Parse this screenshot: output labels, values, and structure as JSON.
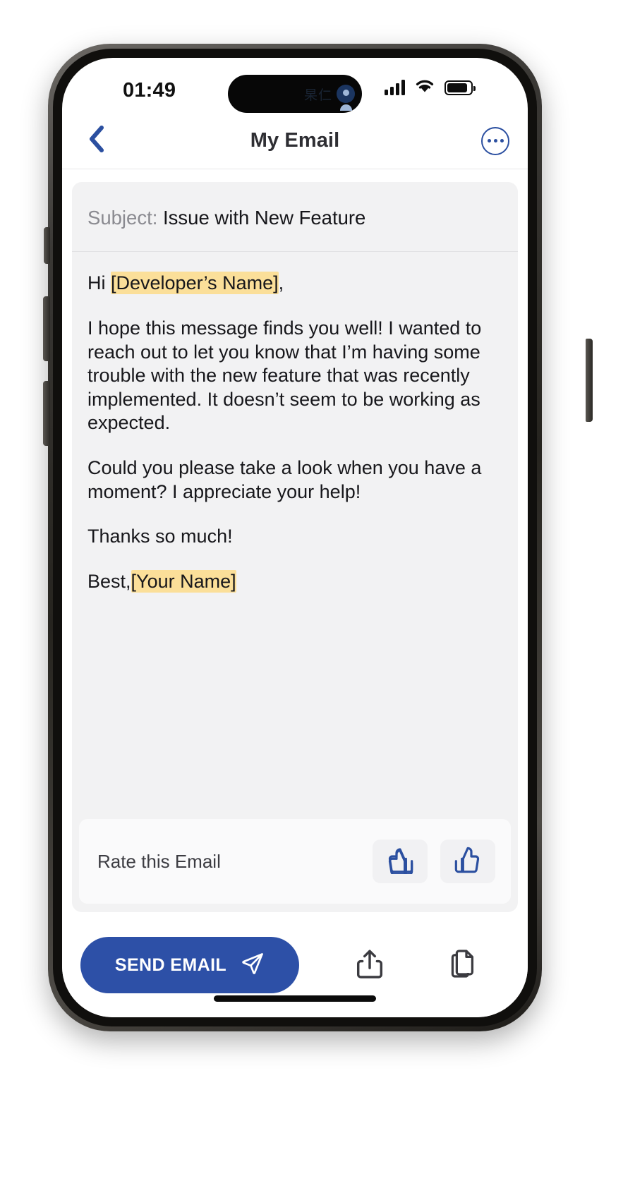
{
  "status_bar": {
    "time": "01:49",
    "island_label": "杲仁",
    "avatar_icon": "person-circle-icon",
    "cellular_icon": "cellular-bars-icon",
    "wifi_icon": "wifi-icon",
    "battery_icon": "battery-icon"
  },
  "nav_bar": {
    "back_icon": "chevron-left-icon",
    "title": "My Email",
    "more_icon": "ellipsis-circle-icon"
  },
  "email": {
    "subject_label": "Subject:",
    "subject_value": " Issue with New Feature",
    "greeting_prefix": "Hi ",
    "greeting_highlight": "[Developer’s Name]",
    "greeting_suffix": ",",
    "paragraph_1": "I hope this message finds you well! I wanted to reach out to let you know that I’m having some trouble with the new feature that was recently implemented. It doesn’t seem to be working as expected.",
    "paragraph_2": "Could you please take a look when you have a moment? I appreciate your help!",
    "paragraph_3": "Thanks so much!",
    "signoff_prefix": "Best,",
    "signoff_highlight": "[Your Name]",
    "highlight_color": "#fbdf99"
  },
  "rating": {
    "label": "Rate this Email",
    "thumbs_down_icon": "thumbs-down-icon",
    "thumbs_up_icon": "thumbs-up-icon",
    "icon_color": "#2b4fa0"
  },
  "actions": {
    "send_label": "SEND EMAIL",
    "send_icon": "paper-plane-icon",
    "send_color": "#2d50a7",
    "share_icon": "share-upload-icon",
    "copy_icon": "copy-documents-icon"
  }
}
